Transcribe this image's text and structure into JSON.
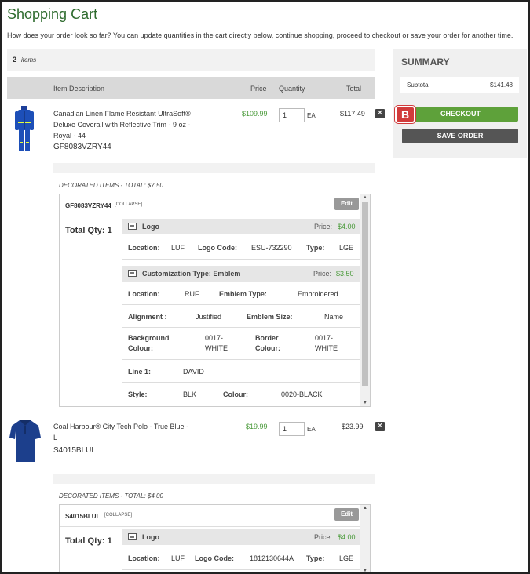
{
  "page": {
    "title": "Shopping Cart",
    "intro": "How does your order look so far? You can update quantities in the cart directly below, continue shopping, proceed to checkout or save your order for another time."
  },
  "cart": {
    "count": "2",
    "count_label": "items",
    "columns": {
      "description": "Item Description",
      "price": "Price",
      "quantity": "Quantity",
      "total": "Total"
    },
    "items": [
      {
        "description": "Canadian Linen Flame Resistant UltraSoft® Deluxe Coverall with Reflective Trim - 9 oz - Royal - 44",
        "sku": "GF8083VZRY44",
        "price": "$109.99",
        "qty": "1",
        "unit": "EA",
        "total": "$117.49",
        "remove": "✕",
        "decoration": {
          "title": "DECORATED ITEMS - TOTAL: $7.50",
          "code": "GF8083VZRY44",
          "collapse": "[COLLAPSE]",
          "edit": "Edit",
          "total_qty": "Total Qty: 1",
          "logo": {
            "name": "Logo",
            "price_label": "Price:",
            "price": "$4.00",
            "location_label": "Location:",
            "location": "LUF",
            "code_label": "Logo Code:",
            "code": "ESU-732290",
            "type_label": "Type:",
            "type": "LGE"
          },
          "custom": {
            "name": "Customization Type: Emblem",
            "price_label": "Price:",
            "price": "$3.50",
            "location_label": "Location:",
            "location": "RUF",
            "emblem_type_label": "Emblem Type:",
            "emblem_type": "Embroidered",
            "alignment_label": "Alignment :",
            "alignment": "Justified",
            "emblem_size_label": "Emblem Size:",
            "emblem_size": "Name",
            "bg_label_1": "Background",
            "bg_label_2": "Colour:",
            "bg_value_1": "0017-",
            "bg_value_2": "WHITE",
            "border_label_1": "Border",
            "border_label_2": "Colour:",
            "border_value_1": "0017-",
            "border_value_2": "WHITE",
            "line1_label": "Line 1:",
            "line1": "DAVID",
            "style_label": "Style:",
            "style": "BLK",
            "colour_label": "Colour:",
            "colour": "0020-BLACK"
          }
        }
      },
      {
        "description_1": "Coal Harbour® City Tech Polo - True Blue -",
        "description_2": "L",
        "sku": "S4015BLUL",
        "price": "$19.99",
        "qty": "1",
        "unit": "EA",
        "total": "$23.99",
        "remove": "✕",
        "decoration": {
          "title": "DECORATED ITEMS - TOTAL: $4.00",
          "code": "S4015BLUL",
          "collapse": "[COLLAPSE]",
          "edit": "Edit",
          "total_qty": "Total Qty: 1",
          "logo": {
            "name": "Logo",
            "price_label": "Price:",
            "price": "$4.00",
            "location_label": "Location:",
            "location": "LUF",
            "code_label": "Logo Code:",
            "code": "1812130644A",
            "type_label": "Type:",
            "type": "LGE"
          }
        }
      }
    ]
  },
  "summary": {
    "title": "SUMMARY",
    "subtotal_label": "Subtotal",
    "subtotal": "$141.48",
    "checkout": "CHECKOUT",
    "save": "SAVE ORDER",
    "badge": "B"
  },
  "colors": {
    "accent_green": "#5ea13a",
    "title_green": "#2e6b2e",
    "badge_red": "#d13b3b"
  }
}
